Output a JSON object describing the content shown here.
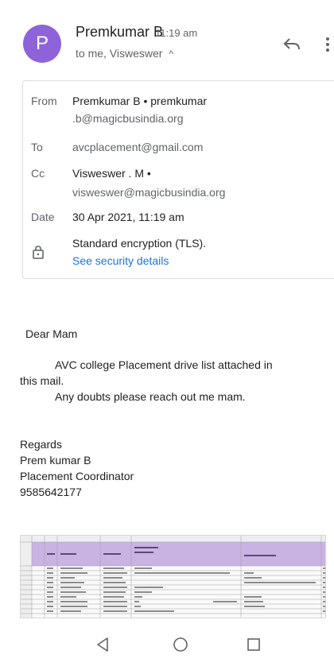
{
  "header": {
    "avatar_letter": "P",
    "sender_name": "Premkumar B",
    "time": "11:19 am",
    "to_summary": "to me, Visweswer",
    "chevron": "^"
  },
  "details": {
    "from_label": "From",
    "from_value_line1": "Premkumar B • premkumar",
    "from_value_line2": ".b@magicbusindia.org",
    "to_label": "To",
    "to_value": "avcplacement@gmail.com",
    "cc_label": "Cc",
    "cc_value_line1": "Visweswer . M •",
    "cc_value_line2": "visweswer@magicbusindia.org",
    "date_label": "Date",
    "date_value": "30 Apr 2021, 11:19 am",
    "encryption": "Standard encryption (TLS).",
    "security_link": "See security details"
  },
  "message": {
    "greeting": "Dear Mam",
    "line1": "AVC college Placement drive list attached in",
    "line1b": "this mail.",
    "line2": "Any doubts please reach out me mam.",
    "regards": "Regards",
    "name": "Prem kumar B",
    "title": "Placement Coordinator",
    "phone": "9585642177"
  },
  "icons": {
    "reply": "reply-icon",
    "more": "more-vert-icon",
    "lock": "lock-icon",
    "back": "nav-back-icon",
    "home": "nav-home-icon",
    "recent": "nav-recent-icon"
  },
  "colors": {
    "avatar": "#8e63d9",
    "link": "#1a73e8",
    "header_band": "#c9b3e3"
  }
}
